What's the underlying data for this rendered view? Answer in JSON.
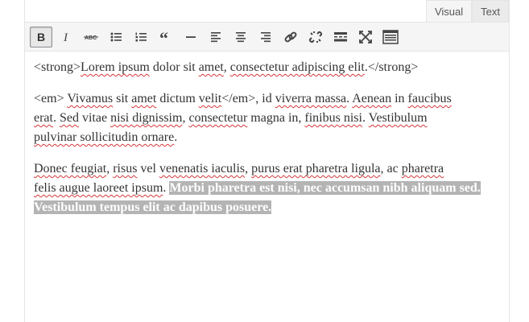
{
  "tabs": [
    {
      "label": "Visual",
      "active": true
    },
    {
      "label": "Text",
      "active": false
    }
  ],
  "toolbar": {
    "buttons": [
      {
        "name": "bold",
        "icon": "bold-icon",
        "active": true
      },
      {
        "name": "italic",
        "icon": "italic-icon"
      },
      {
        "name": "strikethrough",
        "icon": "strikethrough-icon"
      },
      {
        "name": "bulleted-list",
        "icon": "bulleted-list-icon"
      },
      {
        "name": "numbered-list",
        "icon": "numbered-list-icon"
      },
      {
        "name": "blockquote",
        "icon": "quote-icon"
      },
      {
        "name": "horizontal-line",
        "icon": "horizontal-line-icon"
      },
      {
        "name": "align-left",
        "icon": "align-left-icon"
      },
      {
        "name": "align-center",
        "icon": "align-center-icon"
      },
      {
        "name": "align-right",
        "icon": "align-right-icon"
      },
      {
        "name": "insert-link",
        "icon": "link-icon"
      },
      {
        "name": "remove-link",
        "icon": "unlink-icon"
      },
      {
        "name": "read-more",
        "icon": "read-more-icon"
      },
      {
        "name": "fullscreen",
        "icon": "fullscreen-icon"
      },
      {
        "name": "toolbar-toggle",
        "icon": "kitchen-sink-icon"
      }
    ]
  },
  "content": {
    "p1": {
      "t1": "<strong>",
      "t2": "Lorem ipsum",
      "t3": " dolor sit ",
      "t4": "amet",
      "t5": ", ",
      "t6": "consectetur adipiscing elit",
      "t7": ".</strong>"
    },
    "p2": {
      "t1": "<em> ",
      "t2": "Vivamus",
      "t3": " sit ",
      "t4": "amet",
      "t5": " dictum ",
      "t6": "velit",
      "t7": "</em>, id ",
      "t8": "viverra massa",
      "t9": ". ",
      "t10": "Aenean",
      "t11": " in ",
      "t12": "faucibus",
      "t13": "erat",
      "t14": ". ",
      "t15": "Sed",
      "t16": " vitae ",
      "t17": "nisi dignissim",
      "t18": ", ",
      "t19": "consectetur",
      "t20": " magna in, ",
      "t21": "finibus nisi",
      "t22": ". ",
      "t23": "Vestibulum",
      "t24": "pulvinar sollicitudin ornare",
      "t25": "."
    },
    "p3": {
      "t1": "Donec feugiat",
      "t2": ", ",
      "t3": "risus",
      "t4": " vel ",
      "t5": "venenatis iaculis",
      "t6": ", ",
      "t7": "purus erat pharetra ligula",
      "t8": ", ac ",
      "t9": "pharetra",
      "t10": "felis augue laoreet ipsum",
      "t11": ". ",
      "selected": "Morbi pharetra est nisi, nec accumsan nibh aliquam sed. Vestibulum tempus elit ac dapibus posuere."
    }
  },
  "colors": {
    "selection_bg": "#b4b4b4",
    "spellcheck_underline": "#d63638",
    "toolbar_bg": "#f5f5f5"
  }
}
